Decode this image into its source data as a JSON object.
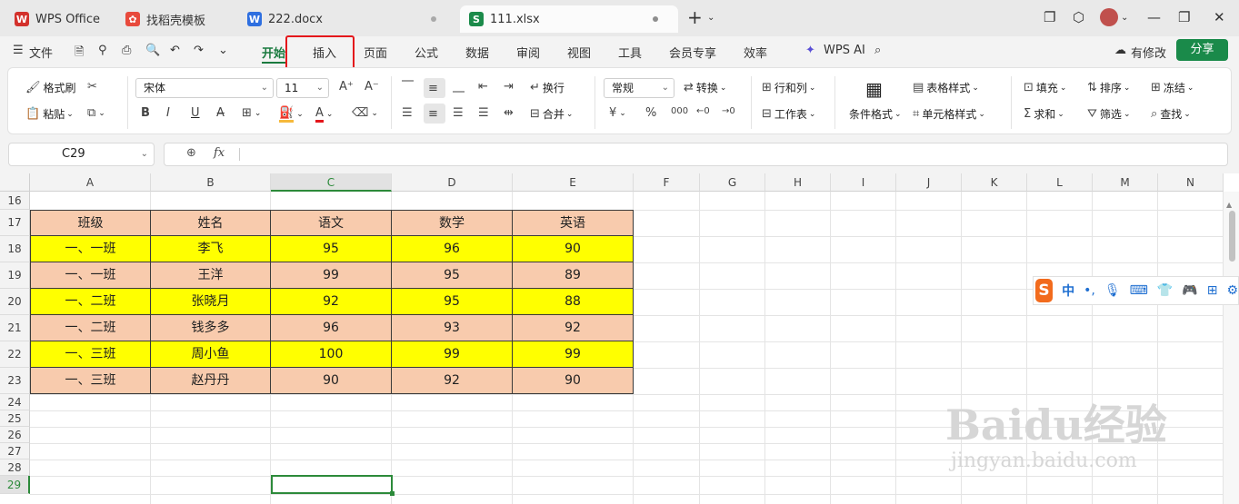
{
  "tabs": [
    {
      "label": "WPS Office",
      "logo": "W",
      "color": "#d3312c"
    },
    {
      "label": "找稻壳模板",
      "logo": "✿",
      "color": "#e84a3c"
    },
    {
      "label": "222.docx",
      "logo": "W",
      "color": "#2e6fe0"
    },
    {
      "label": "111.xlsx",
      "logo": "S",
      "color": "#1b8a4a"
    }
  ],
  "menu": {
    "file": "文件",
    "items": [
      "开始",
      "插入",
      "页面",
      "公式",
      "数据",
      "审阅",
      "视图",
      "工具",
      "会员专享",
      "效率"
    ],
    "wps_ai": "WPS AI",
    "modified": "有修改",
    "share": "分享"
  },
  "ribbon": {
    "format_painter": "格式刷",
    "paste": "粘贴",
    "font_name": "宋体",
    "font_size": "11",
    "wrap": "换行",
    "merge": "合并",
    "number_format": "常规",
    "convert": "转换",
    "rows_cols": "行和列",
    "worksheet": "工作表",
    "conditional_format": "条件格式",
    "table_style": "表格样式",
    "cell_style": "单元格样式",
    "fill": "填充",
    "sort": "排序",
    "freeze": "冻结",
    "sum": "求和",
    "filter": "筛选",
    "find": "查找"
  },
  "formula_bar": {
    "name_box": "C29",
    "fx": "fx",
    "value": ""
  },
  "columns": [
    "A",
    "B",
    "C",
    "D",
    "E",
    "F",
    "G",
    "H",
    "I",
    "J",
    "K",
    "L",
    "M",
    "N"
  ],
  "rows": [
    "16",
    "17",
    "18",
    "19",
    "20",
    "21",
    "22",
    "23",
    "24",
    "25",
    "26",
    "27",
    "28",
    "29"
  ],
  "table": {
    "header": [
      "班级",
      "姓名",
      "语文",
      "数学",
      "英语"
    ],
    "data": [
      [
        "一、一班",
        "李飞",
        "95",
        "96",
        "90"
      ],
      [
        "一、一班",
        "王洋",
        "99",
        "95",
        "89"
      ],
      [
        "一、二班",
        "张晓月",
        "92",
        "95",
        "88"
      ],
      [
        "一、二班",
        "钱多多",
        "96",
        "93",
        "92"
      ],
      [
        "一、三班",
        "周小鱼",
        "100",
        "99",
        "99"
      ],
      [
        "一、三班",
        "赵丹丹",
        "90",
        "92",
        "90"
      ]
    ],
    "colors": {
      "peach": "#f8cbad",
      "yellow": "#ffff00"
    }
  },
  "ime": {
    "label": "中"
  },
  "watermark": {
    "brand": "Baidu经验",
    "url": "jingyan.baidu.com"
  }
}
